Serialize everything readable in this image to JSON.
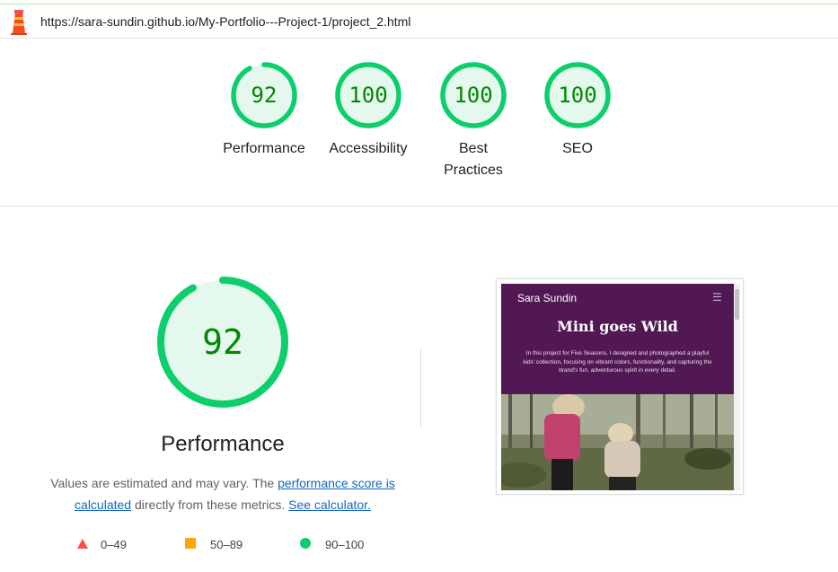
{
  "url_bar": {
    "logo_icon": "lighthouse-icon",
    "url": "https://sara-sundin.github.io/My-Portfolio---Project-1/project_2.html"
  },
  "colors": {
    "pass": "#0cce6b",
    "pass_text": "#008800",
    "pass_fill": "#e5f8ee",
    "average": "#ffa400",
    "fail": "#ff4e42",
    "link": "#1565c0",
    "hero_purple": "#521854"
  },
  "gauges": [
    {
      "score": "92",
      "value": 92,
      "label": "Performance"
    },
    {
      "score": "100",
      "value": 100,
      "label": "Accessibility"
    },
    {
      "score": "100",
      "value": 100,
      "label": "Best Practices"
    },
    {
      "score": "100",
      "value": 100,
      "label": "SEO"
    }
  ],
  "performance": {
    "score": "92",
    "value": 92,
    "title": "Performance",
    "desc_part1": "Values are estimated and may vary. The ",
    "desc_link1": "performance score is calculated",
    "desc_part2": " directly from these metrics. ",
    "desc_link2": "See calculator."
  },
  "screenshot": {
    "site_name": "Sara Sundin",
    "menu_icon": "hamburger-icon",
    "heading": "Mini goes Wild",
    "body": "In this project for Five Seasons, I designed and photographed a playful kids' collection, focusing on vibrant colors, functionality, and capturing the brand's fun, adventurous spirit in every detail.",
    "photo_description": "two-children-in-forest-photo"
  },
  "legend": [
    {
      "range": "0–49",
      "shape": "triangle-icon"
    },
    {
      "range": "50–89",
      "shape": "square-icon"
    },
    {
      "range": "90–100",
      "shape": "circle-icon"
    }
  ]
}
